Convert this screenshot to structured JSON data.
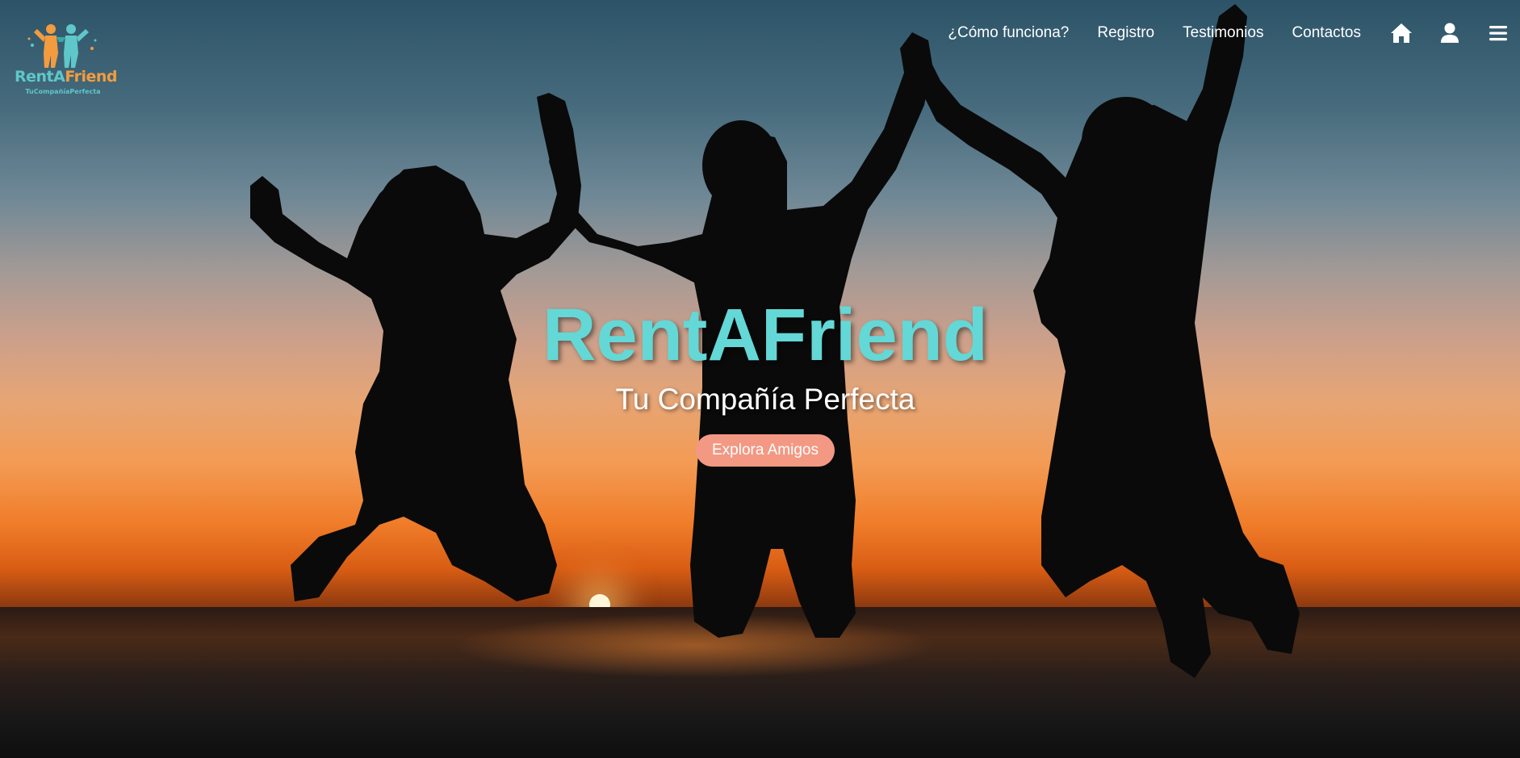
{
  "brand": {
    "logo_name": "RentA",
    "logo_name_accent": "Friend",
    "logo_tagline": "TuCompañíaPerfecta"
  },
  "nav": {
    "links": [
      {
        "label": "¿Cómo funciona?"
      },
      {
        "label": "Registro"
      },
      {
        "label": "Testimonios"
      },
      {
        "label": "Contactos"
      }
    ],
    "icons": [
      "home-icon",
      "user-icon",
      "menu-icon"
    ]
  },
  "hero": {
    "title": "RentAFriend",
    "subtitle": "Tu Compañía Perfecta",
    "cta_label": "Explora Amigos"
  },
  "colors": {
    "accent_teal": "#63d8d6",
    "button_salmon": "#f39883",
    "logo_orange": "#f29c3f"
  }
}
